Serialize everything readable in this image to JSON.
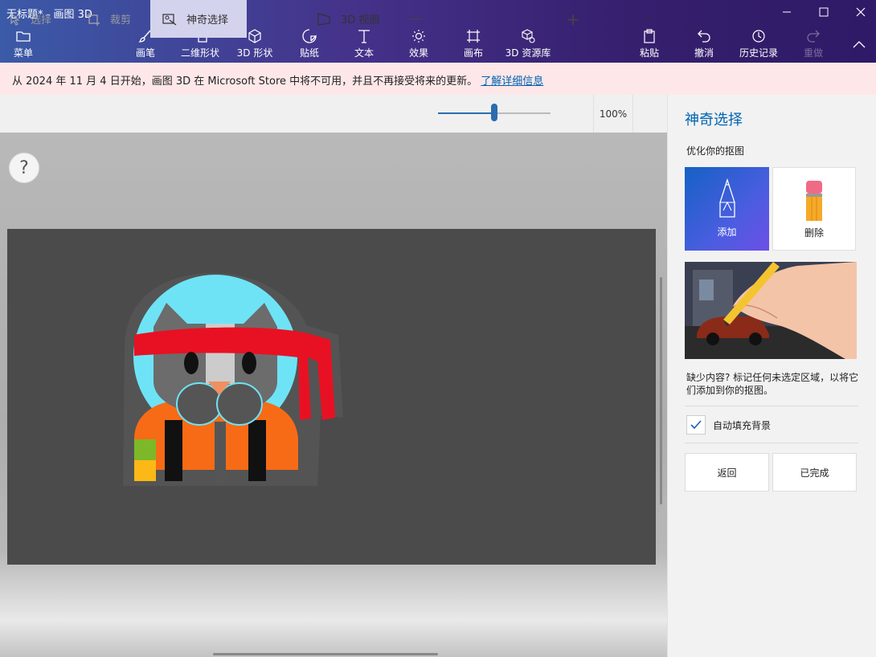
{
  "window": {
    "title": "无标题* - 画图 3D",
    "controls": [
      "minimize",
      "maximize",
      "close"
    ]
  },
  "ribbon": {
    "menu_label": "菜单",
    "tools": [
      {
        "label": "画笔",
        "icon": "brush-icon"
      },
      {
        "label": "二维形状",
        "icon": "2d-shapes-icon"
      },
      {
        "label": "3D 形状",
        "icon": "3d-shapes-icon"
      },
      {
        "label": "贴纸",
        "icon": "stickers-icon"
      },
      {
        "label": "文本",
        "icon": "text-icon"
      },
      {
        "label": "效果",
        "icon": "effects-icon"
      },
      {
        "label": "画布",
        "icon": "canvas-icon"
      },
      {
        "label": "3D 资源库",
        "icon": "3d-library-icon"
      }
    ],
    "paste_label": "粘贴",
    "undo_label": "撤消",
    "history_label": "历史记录",
    "redo_label": "重做"
  },
  "notice": {
    "text": "从 2024 年 11 月 4 日开始，画图 3D 在 Microsoft Store 中将不可用，并且不再接受将来的更新。",
    "link": "了解详细信息"
  },
  "toolbar": {
    "select_label": "选择",
    "crop_label": "裁剪",
    "magic_select_label": "神奇选择",
    "view3d_label": "3D 视图",
    "zoom_out_symbol": "—",
    "zoom_in_symbol": "+",
    "zoom_value": "100%",
    "zoom_level": 0.5,
    "more_symbol": "···"
  },
  "canvas": {
    "help_symbol": "?"
  },
  "panel": {
    "title": "神奇选择",
    "subtitle": "优化你的抠图",
    "add_label": "添加",
    "delete_label": "删除",
    "hint": "缺少内容? 标记任何未选定区域，以将它们添加到你的抠图。",
    "autofill_label": "自动填充背景",
    "autofill_checked": true,
    "back_label": "返回",
    "done_label": "已完成"
  },
  "colors": {
    "accent": "#0063b1",
    "notice_bg": "#fde7e9",
    "canvas_bg": "#4b4b4b",
    "magic_active_bg": "#d4d3ed"
  }
}
